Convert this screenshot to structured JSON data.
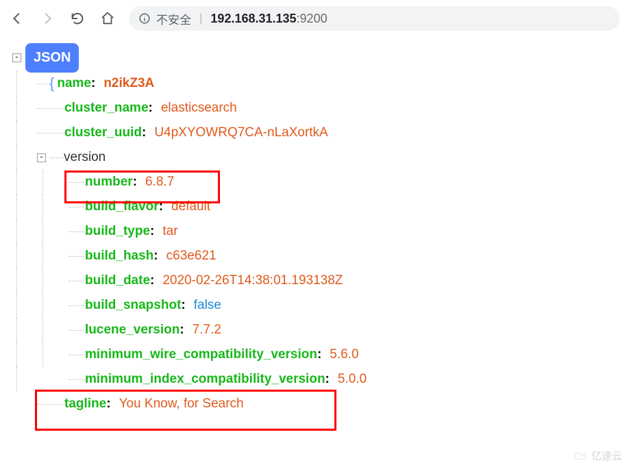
{
  "browser": {
    "security_info": "ⓘ",
    "insecure_label": "不安全",
    "url_ip": "192.168.31.135",
    "url_port": ":9200"
  },
  "tree": {
    "root_label": "JSON",
    "name_key": "name",
    "name_val": "n2ikZ3A",
    "cluster_name_key": "cluster_name",
    "cluster_name_val": "elasticsearch",
    "cluster_uuid_key": "cluster_uuid",
    "cluster_uuid_val": "U4pXYOWRQ7CA-nLaXortkA",
    "version_label": "version",
    "version": {
      "number_key": "number",
      "number_val": "6.8.7",
      "build_flavor_key": "build_flavor",
      "build_flavor_val": "default",
      "build_type_key": "build_type",
      "build_type_val": "tar",
      "build_hash_key": "build_hash",
      "build_hash_val": "c63e621",
      "build_date_key": "build_date",
      "build_date_val": "2020-02-26T14:38:01.193138Z",
      "build_snapshot_key": "build_snapshot",
      "build_snapshot_val": "false",
      "lucene_version_key": "lucene_version",
      "lucene_version_val": "7.7.2",
      "min_wire_key": "minimum_wire_compatibility_version",
      "min_wire_val": "5.6.0",
      "min_index_key": "minimum_index_compatibility_version",
      "min_index_val": "5.0.0"
    },
    "tagline_key": "tagline",
    "tagline_val": "You Know, for Search"
  },
  "watermark": "亿速云"
}
